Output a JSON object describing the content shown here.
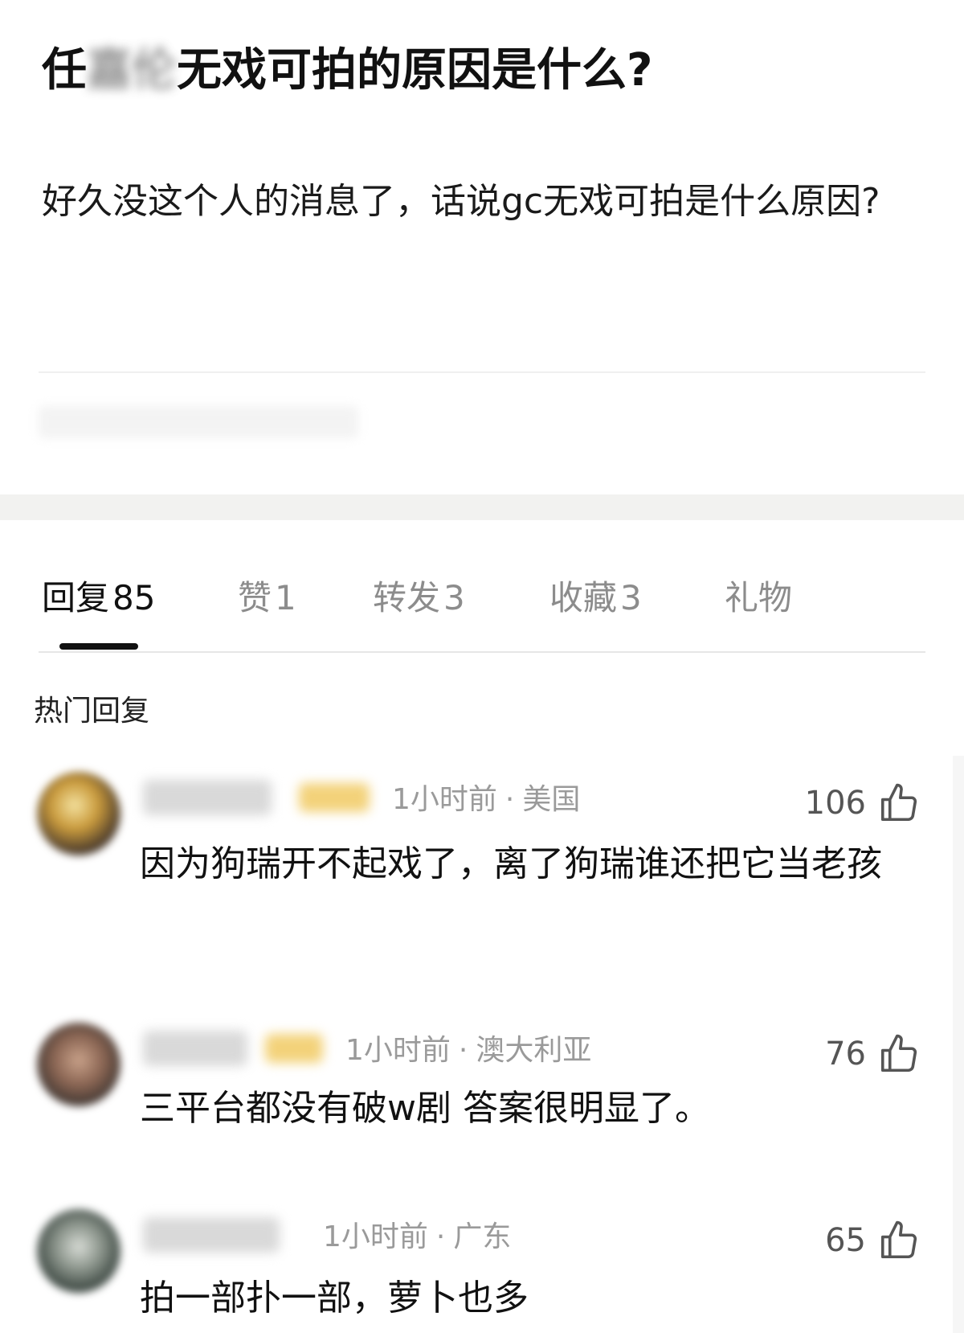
{
  "post": {
    "title_before": "任",
    "title_hidden": "嘉伦",
    "title_after": "无戏可拍的原因是什么?",
    "body": "好久没这个人的消息了，话说gc无戏可拍是什么原因?"
  },
  "tabs": [
    {
      "label": "回复",
      "count": "85"
    },
    {
      "label": "赞",
      "count": "1"
    },
    {
      "label": "转发",
      "count": "3"
    },
    {
      "label": "收藏",
      "count": "3"
    },
    {
      "label": "礼物",
      "count": ""
    }
  ],
  "section_label": "热门回复",
  "comments": [
    {
      "time": "1小时前",
      "location": "美国",
      "likes": "106",
      "text": "因为狗瑞开不起戏了，离了狗瑞谁还把它当老孩"
    },
    {
      "time": "1小时前",
      "location": "澳大利亚",
      "likes": "76",
      "text": "三平台都没有破w剧 答案很明显了。"
    },
    {
      "time": "1小时前",
      "location": "广东",
      "likes": "65",
      "text": "拍一部扑一部，萝卜也多"
    }
  ],
  "icons": {
    "like": "thumbs-up-icon"
  },
  "colors": {
    "accent": "#111111",
    "muted": "#9a9a9a",
    "separator": "#f2f2f0"
  }
}
